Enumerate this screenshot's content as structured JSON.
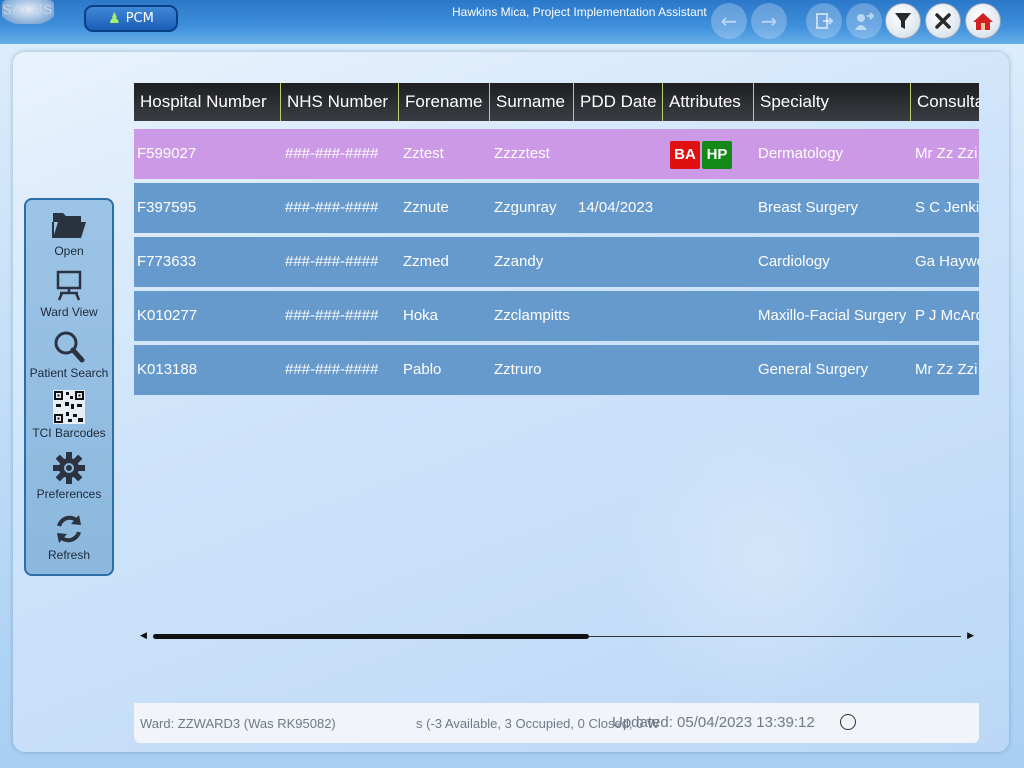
{
  "app": {
    "logo_text": "SALUS",
    "module_button": "PCM",
    "user_title": "Hawkins Mica, Project Implementation Assistant"
  },
  "toolbar": {
    "icons": [
      "back-arrow-icon",
      "forward-arrow-icon",
      "logout-icon",
      "transfer-icon",
      "filter-icon",
      "close-icon",
      "home-icon"
    ]
  },
  "sidebar": {
    "items": [
      {
        "label": "Open",
        "icon": "folder-open-icon"
      },
      {
        "label": "Ward View",
        "icon": "ward-view-icon"
      },
      {
        "label": "Patient Search",
        "icon": "magnifier-icon"
      },
      {
        "label": "TCI Barcodes",
        "icon": "qr-code-icon"
      },
      {
        "label": "Preferences",
        "icon": "gear-icon"
      },
      {
        "label": "Refresh",
        "icon": "refresh-icon"
      }
    ]
  },
  "grid": {
    "columns": [
      "Hospital Number",
      "NHS Number",
      "Forename",
      "Surname",
      "PDD Date",
      "Attributes",
      "Specialty",
      "Consultant"
    ],
    "rows": [
      {
        "hospital_number": "F599027",
        "nhs_number": "###-###-####",
        "forename": "Zztest",
        "surname": "Zzzztest",
        "pdd_date": "",
        "attributes": [
          "BA",
          "HP"
        ],
        "specialty": "Dermatology",
        "consultant": "Mr Zz Zzi",
        "selected": true
      },
      {
        "hospital_number": "F397595",
        "nhs_number": "###-###-####",
        "forename": "Zznute",
        "surname": "Zzgunray",
        "pdd_date": "14/04/2023",
        "attributes": [],
        "specialty": "Breast Surgery",
        "consultant": "S C Jenki",
        "selected": false
      },
      {
        "hospital_number": "F773633",
        "nhs_number": "###-###-####",
        "forename": "Zzmed",
        "surname": "Zzandy",
        "pdd_date": "",
        "attributes": [],
        "specialty": "Cardiology",
        "consultant": "Ga Haywo",
        "selected": false
      },
      {
        "hospital_number": "K010277",
        "nhs_number": "###-###-####",
        "forename": "Hoka",
        "surname": "Zzclampitts",
        "pdd_date": "",
        "attributes": [],
        "specialty": "Maxillo-Facial Surgery",
        "consultant": "P J McArd",
        "selected": false
      },
      {
        "hospital_number": "K013188",
        "nhs_number": "###-###-####",
        "forename": "Pablo",
        "surname": "Zztruro",
        "pdd_date": "",
        "attributes": [],
        "specialty": "General Surgery",
        "consultant": "Mr Zz Zzi",
        "selected": false
      }
    ],
    "badge_colors": {
      "BA": "#e01010",
      "HP": "#138a17"
    },
    "scroll_position": 0.54
  },
  "status": {
    "ward": "Ward: ZZWARD3 (Was RK95082)",
    "beds": "s (-3 Available, 3 Occupied, 0 Closed, 0 W",
    "updated": "Updated: 05/04/2023 13:39:12"
  }
}
